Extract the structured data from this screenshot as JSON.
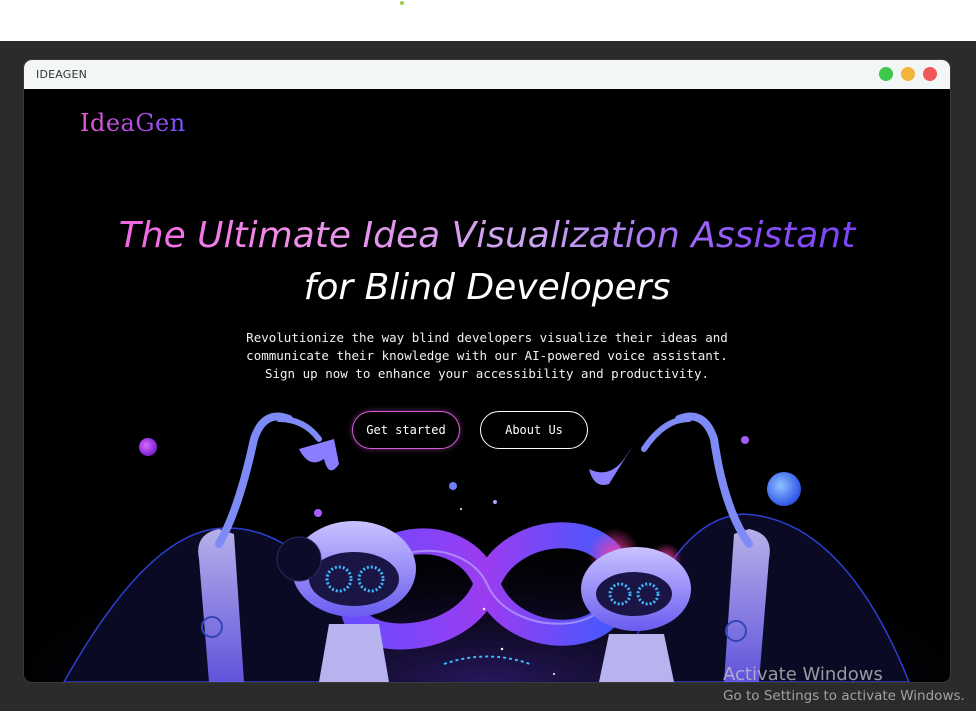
{
  "window": {
    "title": "IDEAGEN"
  },
  "header": {
    "logo": "IdeaGen"
  },
  "hero": {
    "headline_line1": "The Ultimate Idea Visualization Assistant",
    "headline_line2": "for Blind Developers",
    "description": "Revolutionize the way blind developers visualize their ideas and communicate their knowledge with our AI-powered voice assistant. Sign up now to enhance your accessibility and productivity.",
    "primary_button": "Get started",
    "secondary_button": "About Us"
  },
  "watermark": {
    "line1": "Activate Windows",
    "line2": "Go to Settings to activate Windows."
  },
  "colors": {
    "background": "#000000",
    "accent_pink": "#ef4fe0",
    "accent_violet": "#6b3cff",
    "window_green": "#3cc84a",
    "window_yellow": "#f2b43a",
    "window_red": "#f0575a"
  },
  "icons": {
    "maximize": "green-dot-icon",
    "minimize": "yellow-dot-icon",
    "close": "red-dot-icon"
  }
}
